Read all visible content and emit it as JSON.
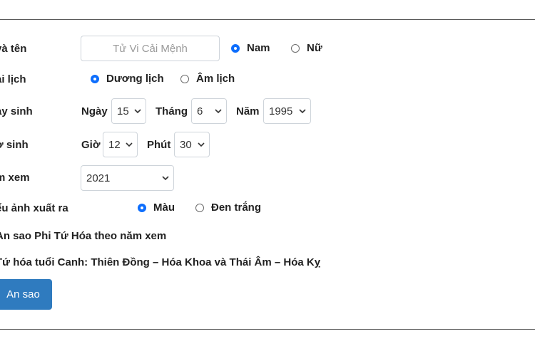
{
  "form": {
    "name_label": "và tên",
    "name_placeholder": "Tử Vi Cải Mệnh",
    "gender_male": "Nam",
    "gender_female": "Nữ",
    "calendar_label": "ại lịch",
    "calendar_solar": "Dương lịch",
    "calendar_lunar": "Âm lịch",
    "birthdate_label": "ày sinh",
    "day_label": "Ngày",
    "day_value": "15",
    "month_label": "Tháng",
    "month_value": "6",
    "year_label": "Năm",
    "year_value": "1995",
    "birthtime_label": "ờ sinh",
    "hour_label": "Giờ",
    "hour_value": "12",
    "minute_label": "Phút",
    "minute_value": "30",
    "viewyear_label": "m xem",
    "viewyear_value": "2021",
    "output_label": "ểu ảnh xuất ra",
    "output_color": "Màu",
    "output_bw": "Đen trắng",
    "note_1": "An sao Phi Tứ Hóa theo năm xem",
    "note_2": "Tứ hóa tuổi Canh: Thiên Đồng – Hóa Khoa và Thái Âm – Hóa Kỵ",
    "submit_label": "An sao"
  },
  "colors": {
    "accent": "#0d6efd",
    "button": "#2f7bbf"
  }
}
